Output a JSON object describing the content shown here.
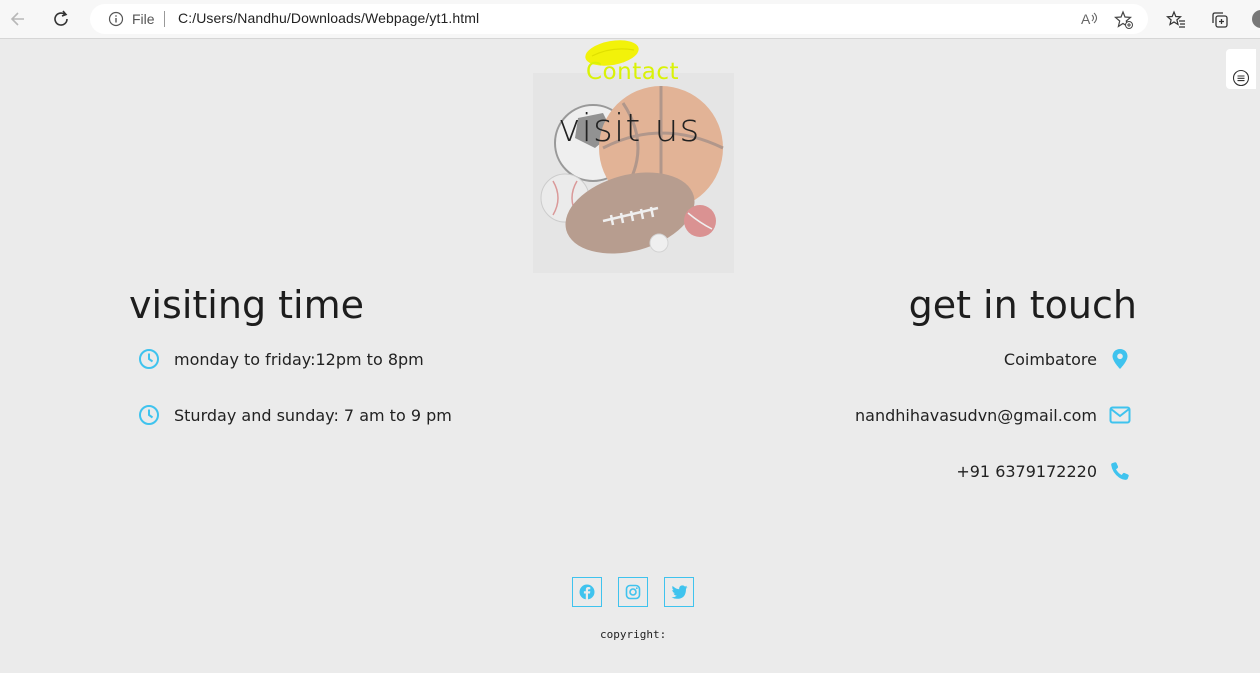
{
  "browser": {
    "file_label": "File",
    "url": "C:/Users/Nandhu/Downloads/Webpage/yt1.html",
    "read_aloud_label": "A",
    "icons": [
      "back-icon",
      "reload-icon",
      "info-icon",
      "read-aloud-icon",
      "favorite-star-icon",
      "favorites-list-icon",
      "collections-icon",
      "profile-icon"
    ]
  },
  "hero": {
    "brand": "Contact",
    "heading": "visit us"
  },
  "visiting": {
    "heading": "visiting time",
    "items": [
      {
        "icon": "clock-icon",
        "text": "monday to friday:12pm to 8pm"
      },
      {
        "icon": "clock-icon",
        "text": "Sturday and sunday: 7 am to 9 pm"
      }
    ]
  },
  "contact": {
    "heading": "get in touch",
    "location": "Coimbatore",
    "email": "nandhihavasudvn@gmail.com",
    "phone": "+91 6379172220",
    "icons": [
      "location-pin-icon",
      "envelope-icon",
      "phone-icon"
    ]
  },
  "footer": {
    "social": [
      "facebook-icon",
      "instagram-icon",
      "twitter-icon"
    ],
    "copyright": "copyright:"
  },
  "colors": {
    "accent": "#3fc3ee",
    "brand": "#d9f207",
    "background": "#ebebeb"
  }
}
